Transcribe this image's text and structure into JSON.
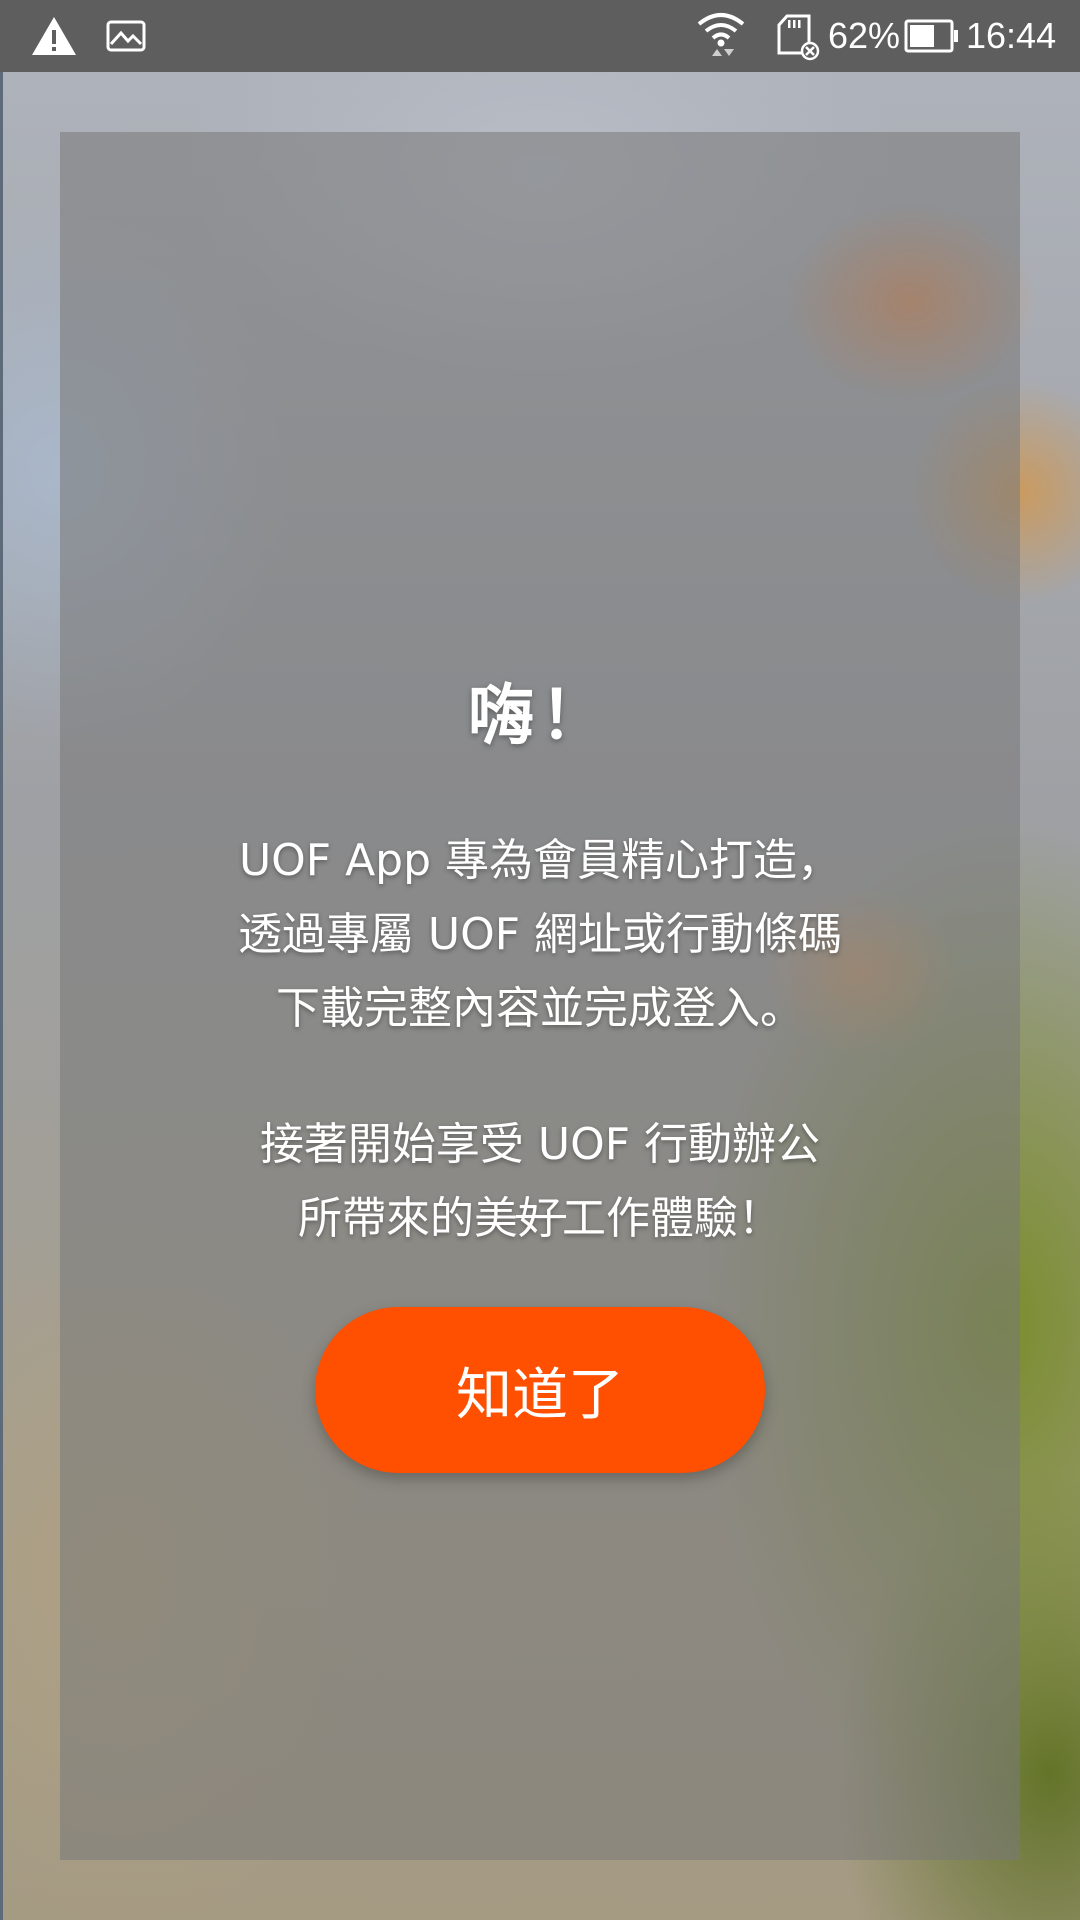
{
  "status_bar": {
    "icons": [
      "warning-icon",
      "image-icon",
      "wifi-icon",
      "sd-card-icon",
      "battery-icon"
    ],
    "battery_percent_text": "62%",
    "battery_level": 0.62,
    "time": "16:44"
  },
  "dialog": {
    "title": "嗨！",
    "paragraph1_lines": [
      "UOF App 專為會員精心打造，",
      "透過專屬 UOF 網址或行動條碼",
      "下載完整內容並完成登入。"
    ],
    "paragraph2_lines": [
      "接著開始享受 UOF 行動辦公",
      "所帶來的美好工作體驗！"
    ],
    "button_label": "知道了"
  },
  "colors": {
    "accent": "#ff4f00",
    "status_bar": "#5e5e5e",
    "card_overlay": "#787878"
  }
}
